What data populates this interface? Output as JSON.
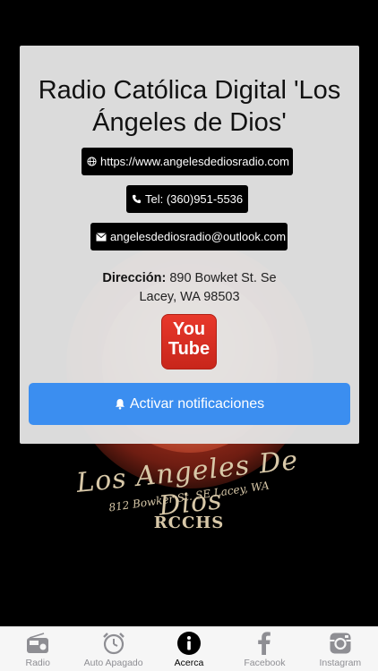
{
  "background": {
    "emblem_text_1": "Los Angeles De Dios",
    "emblem_text_2": "812 Bowker St. SE Lacey, WA",
    "emblem_text_3": "RCCHS"
  },
  "card": {
    "title": "Radio Católica Digital 'Los Ángeles de Dios'",
    "website": "https://www.angelesdediosradio.com",
    "phone": "Tel: (360)951-5536",
    "email": "angelesdediosradio@outlook.com",
    "address_label": "Dirección:",
    "address_line1": "890 Bowket St. Se",
    "address_line2": "Lacey, WA 98503",
    "youtube_top": "You",
    "youtube_bottom": "Tube",
    "notify_label": "Activar notificaciones",
    "accent_color": "#3b8ef0"
  },
  "tabs": [
    {
      "label": "Radio",
      "icon": "radio-icon",
      "active": false
    },
    {
      "label": "Auto Apagado",
      "icon": "alarm-clock-icon",
      "active": false
    },
    {
      "label": "Acerca",
      "icon": "info-icon",
      "active": true
    },
    {
      "label": "Facebook",
      "icon": "facebook-icon",
      "active": false
    },
    {
      "label": "Instagram",
      "icon": "instagram-icon",
      "active": false
    }
  ]
}
